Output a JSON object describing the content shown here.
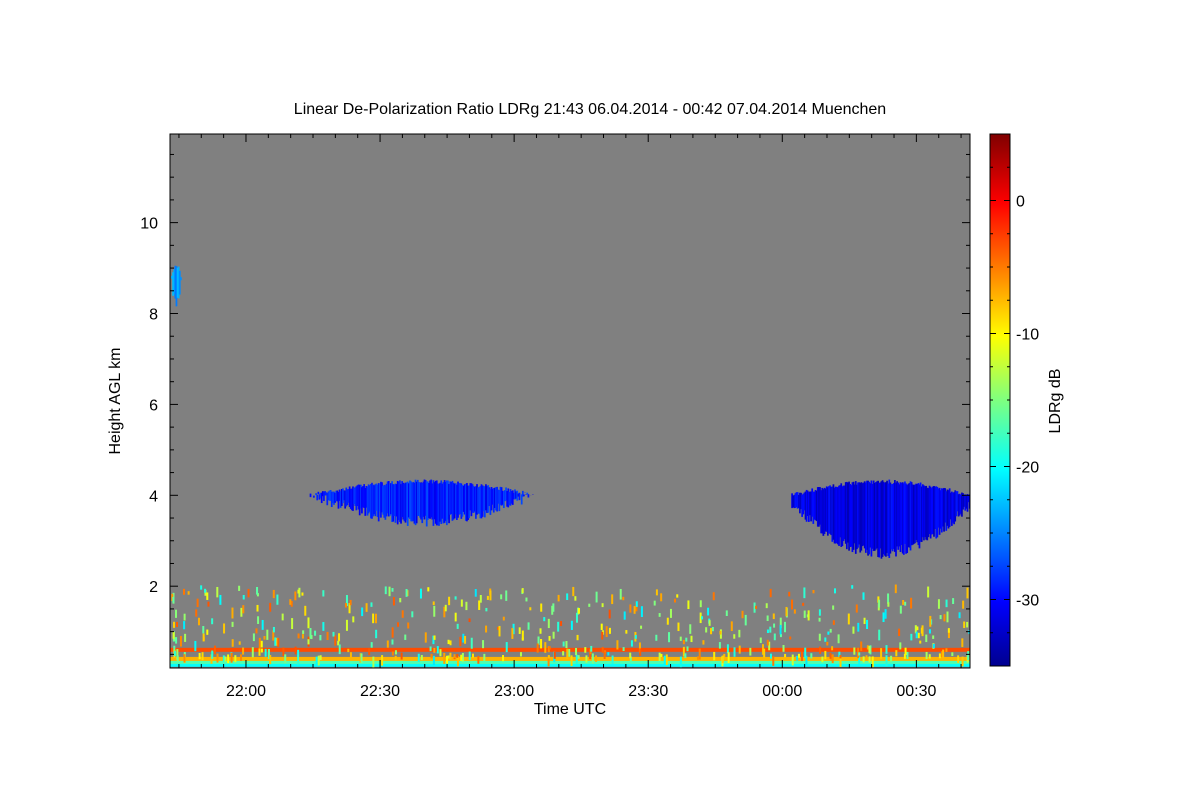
{
  "chart_data": {
    "type": "heatmap",
    "title": "Linear De-Polarization Ratio LDRg   21:43 06.04.2014 - 00:42 07.04.2014 Muenchen",
    "xlabel": "Time UTC",
    "ylabel": "Height AGL km",
    "colorbar_label": "LDRg dB",
    "x_tick_labels": [
      "22:00",
      "22:30",
      "23:00",
      "23:30",
      "00:00",
      "00:30"
    ],
    "x_tick_minutes": [
      17,
      47,
      77,
      107,
      137,
      167
    ],
    "xlim_minutes_since_start": [
      0,
      179
    ],
    "ylim_km": [
      0.2,
      11.95
    ],
    "y_tick_labels": [
      "2",
      "4",
      "6",
      "8",
      "10"
    ],
    "y_ticks_km": [
      2,
      4,
      6,
      8,
      10
    ],
    "colorbar_range_db": [
      -35,
      5
    ],
    "colorbar_tick_labels": [
      "0",
      "-10",
      "-20",
      "-30"
    ],
    "colorbar_ticks_db": [
      0,
      -10,
      -20,
      -30
    ],
    "background_color": "#808080",
    "features": [
      {
        "name": "cirrus",
        "t_start": 0,
        "t_end": 2.5,
        "h_bottom": 8.1,
        "h_top": 9.1,
        "ldr_db": -24
      },
      {
        "name": "cloud-layer-1",
        "t_start": 31,
        "t_end": 82,
        "h_bottom": 3.3,
        "h_top": 4.35,
        "ldr_db": -29
      },
      {
        "name": "cloud-layer-2",
        "t_start": 139,
        "t_end": 179,
        "h_bottom": 2.6,
        "h_top": 4.35,
        "ldr_db": -31
      }
    ],
    "near_surface_bands": [
      {
        "h": 0.27,
        "ldr_db": -20
      },
      {
        "h": 0.33,
        "ldr_db": -17
      },
      {
        "h": 0.4,
        "ldr_db": -7
      },
      {
        "h": 0.6,
        "ldr_db": -3
      }
    ]
  }
}
